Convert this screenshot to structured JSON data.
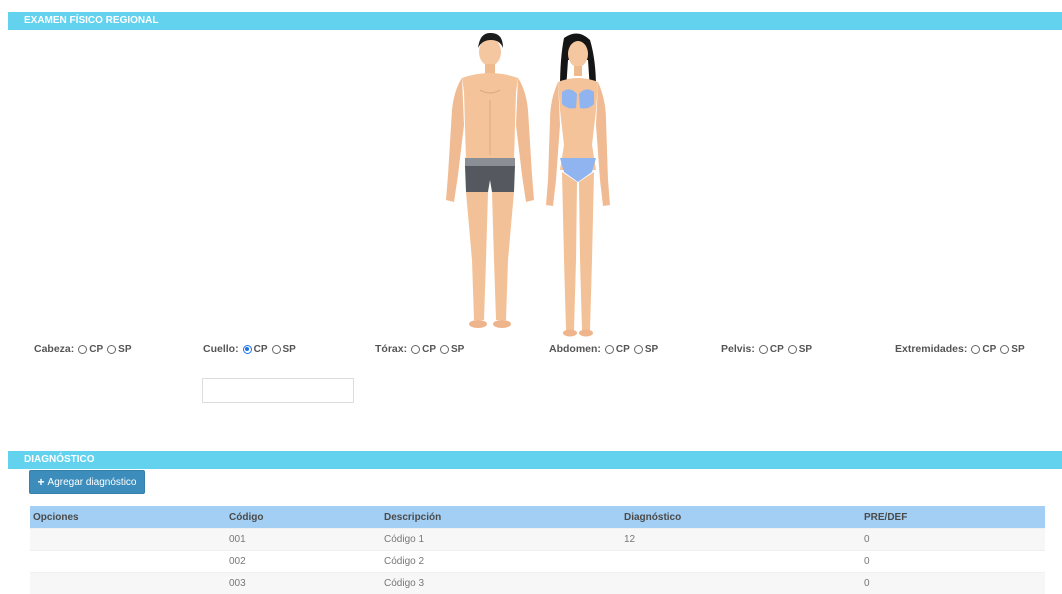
{
  "sections": {
    "physical_exam_title": "EXAMEN FÍSICO REGIONAL",
    "diagnosis_title": "DIAGNÓSTICO"
  },
  "regions": [
    {
      "label": "Cabeza:",
      "opt1": "CP",
      "opt2": "SP",
      "selected": "none"
    },
    {
      "label": "Cuello:",
      "opt1": "CP",
      "opt2": "SP",
      "selected": "CP"
    },
    {
      "label": "Tórax:",
      "opt1": "CP",
      "opt2": "SP",
      "selected": "none"
    },
    {
      "label": "Abdomen:",
      "opt1": "CP",
      "opt2": "SP",
      "selected": "none"
    },
    {
      "label": "Pelvis:",
      "opt1": "CP",
      "opt2": "SP",
      "selected": "none"
    },
    {
      "label": "Extremidades:",
      "opt1": "CP",
      "opt2": "SP",
      "selected": "none"
    }
  ],
  "neck_input": {
    "value": "",
    "placeholder": ""
  },
  "add_button": {
    "label": "Agregar diagnóstico",
    "icon": "plus-icon"
  },
  "table": {
    "headers": [
      "Opciones",
      "Código",
      "Descripción",
      "Diagnóstico",
      "PRE/DEF"
    ],
    "rows": [
      [
        "",
        "001",
        "Código 1",
        "12",
        "0"
      ],
      [
        "",
        "002",
        "Código 2",
        "",
        "0"
      ],
      [
        "",
        "003",
        "Código 3",
        "",
        "0"
      ]
    ]
  },
  "colors": {
    "section_header": "#62d2ef",
    "table_header": "#a3cff4",
    "button": "#3c8dbc",
    "radio_checked": "#1a73e8"
  }
}
